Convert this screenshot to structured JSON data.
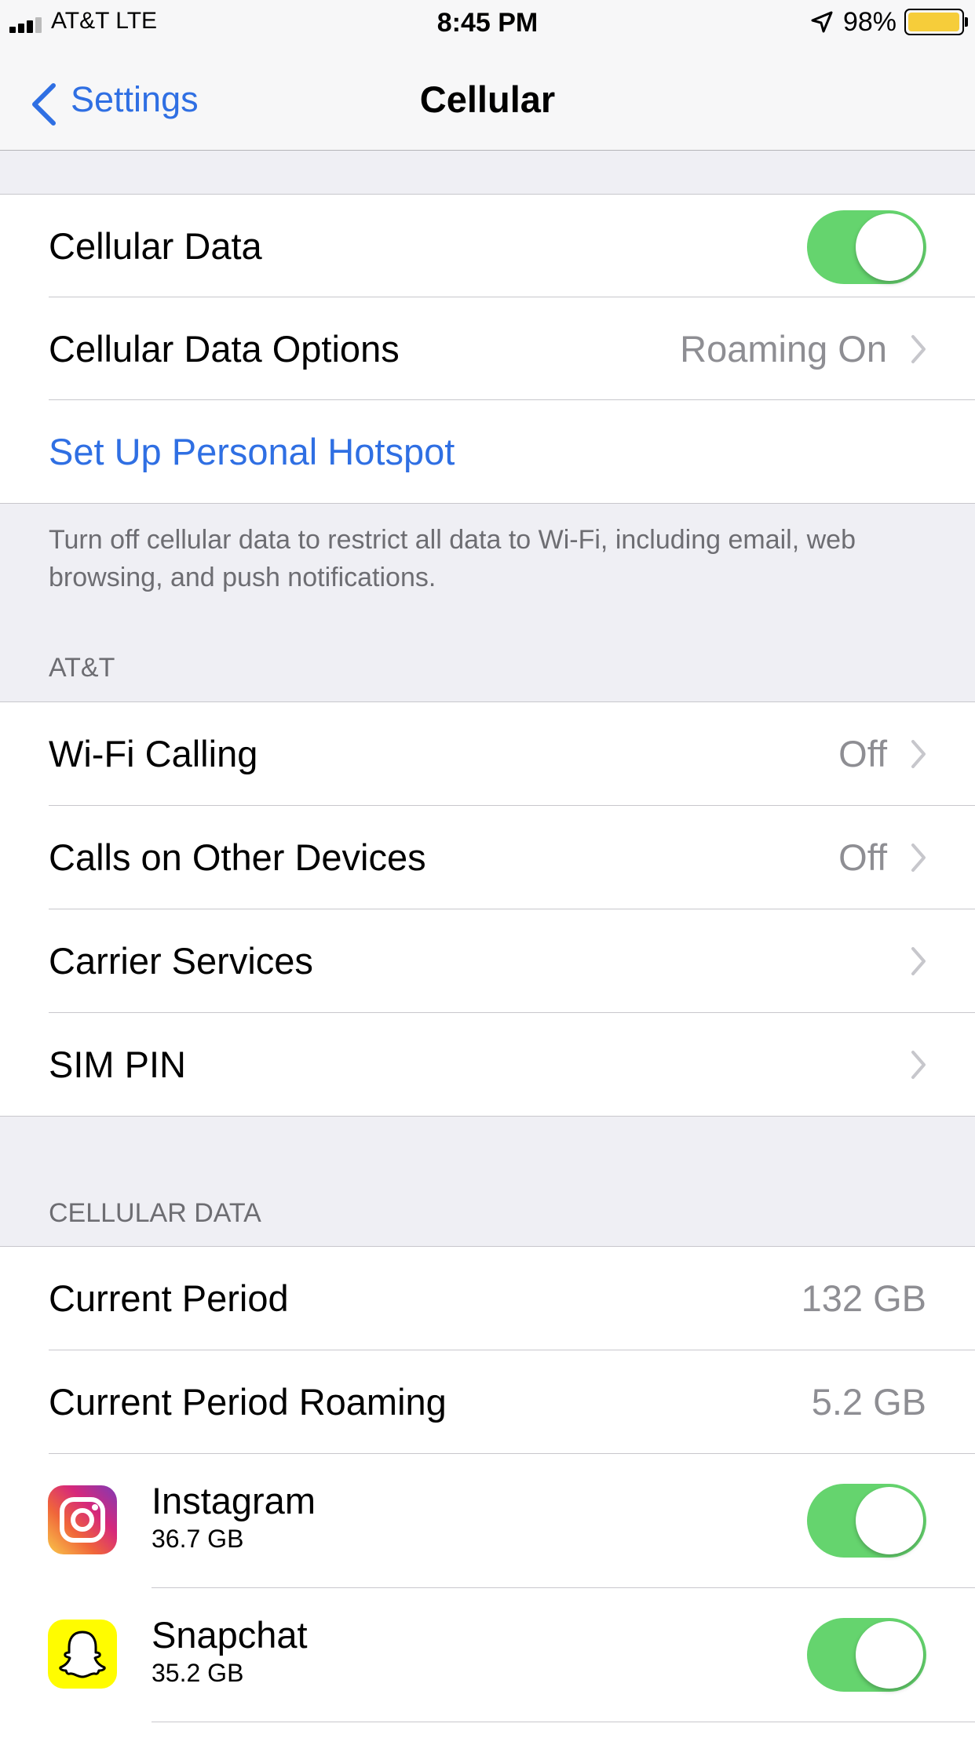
{
  "status": {
    "carrier": "AT&T  LTE",
    "time": "8:45 PM",
    "battery": "98%",
    "battery_level": 0.98
  },
  "nav": {
    "back_label": "Settings",
    "title": "Cellular"
  },
  "group1": {
    "cellular_data_label": "Cellular Data",
    "cellular_data_on": true,
    "options_label": "Cellular Data Options",
    "options_value": "Roaming On",
    "hotspot_label": "Set Up Personal Hotspot"
  },
  "footer": {
    "text": "Turn off cellular data to restrict all data to Wi-Fi, including email, web browsing, and push notifications."
  },
  "carrier_section": {
    "header": "AT&T",
    "wifi_calling_label": "Wi-Fi Calling",
    "wifi_calling_value": "Off",
    "other_devices_label": "Calls on Other Devices",
    "other_devices_value": "Off",
    "carrier_services_label": "Carrier Services",
    "sim_pin_label": "SIM PIN"
  },
  "data_section": {
    "header": "CELLULAR DATA",
    "current_period_label": "Current Period",
    "current_period_value": "132 GB",
    "roaming_label": "Current Period Roaming",
    "roaming_value": "5.2 GB",
    "apps": [
      {
        "name": "Instagram",
        "size": "36.7 GB",
        "enabled": true,
        "icon": "instagram-icon"
      },
      {
        "name": "Snapchat",
        "size": "35.2 GB",
        "enabled": true,
        "icon": "snapchat-icon"
      }
    ]
  },
  "colors": {
    "accent": "#2f6fe3",
    "switch_on": "#65d46e",
    "battery": "#f6cd3a",
    "background": "#efeff4"
  }
}
